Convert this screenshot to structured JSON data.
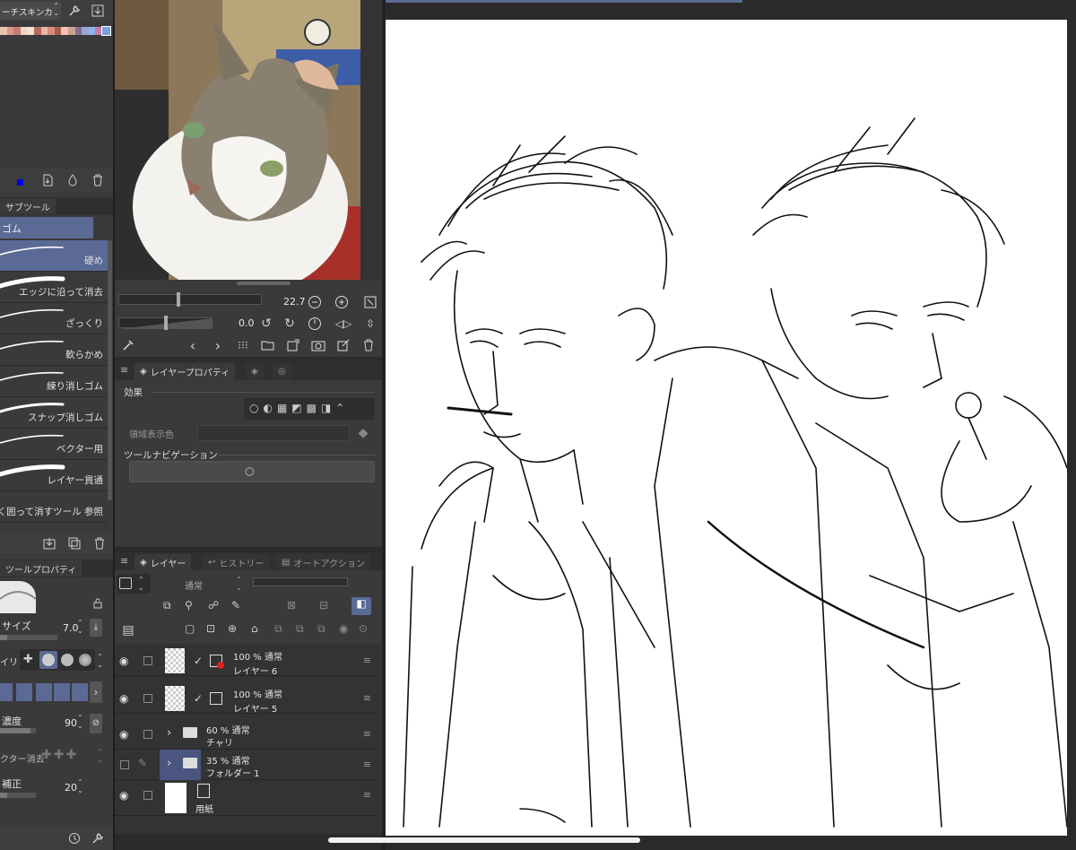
{
  "palette": {
    "set_name": "ーチスキンカ",
    "colors": [
      "#e8c4b0",
      "#d99a8a",
      "#c97a6e",
      "#f0d4c4",
      "#f5e1d3",
      "#b86a5e",
      "#e6b7a5",
      "#d88e7e",
      "#a85b52",
      "#f2c2b0",
      "#caa18e",
      "#8a6d8a",
      "#9aa5d8",
      "#8fb3e8",
      "#c87aa8",
      "#7aa0e0"
    ]
  },
  "subtool": {
    "tab_label": "サブツール",
    "group_label": "ゴム",
    "brushes": [
      {
        "label": "硬め"
      },
      {
        "label": "エッジに沿って消去"
      },
      {
        "label": "ざっくり"
      },
      {
        "label": "軟らかめ"
      },
      {
        "label": "練り消しゴム"
      },
      {
        "label": "スナップ消しゴム"
      },
      {
        "label": "ベクター用"
      },
      {
        "label": "レイヤー貫通"
      },
      {
        "label": "く囲って消すツール 参照"
      }
    ]
  },
  "tool_property": {
    "tab_label": "ツールプロパティ",
    "size_label": "サイズ",
    "size_value": "7.0",
    "hardness_label": "イリ",
    "density_label": "濃度",
    "density_value": "90",
    "vector_erase_label": "クター消去",
    "correction_label": "補正",
    "correction_value": "20"
  },
  "navigator": {
    "zoom_value": "22.7",
    "rotate_value": "0.0"
  },
  "layer_property": {
    "tab_label": "レイヤープロパティ",
    "effect_label": "効果",
    "region_color_label": "領域表示色",
    "tool_nav_label": "ツールナビゲーション"
  },
  "layer_panel": {
    "tabs": [
      "レイヤー",
      "ヒストリー",
      "オートアクション"
    ],
    "blend_mode": "通常",
    "layers": [
      {
        "pct": "100 %",
        "mode": "通常",
        "name": "レイヤー 6"
      },
      {
        "pct": "100 %",
        "mode": "通常",
        "name": "レイヤー 5"
      },
      {
        "pct": "60 %",
        "mode": "通常",
        "name": "チャリ"
      },
      {
        "pct": "35 %",
        "mode": "通常",
        "name": "フォルダー 1"
      },
      {
        "pct": "",
        "mode": "",
        "name": "用紙"
      }
    ]
  },
  "colors": {
    "accent": "#5a6a95",
    "selected_row": "#4a5680",
    "canvas": "#ffffff"
  }
}
